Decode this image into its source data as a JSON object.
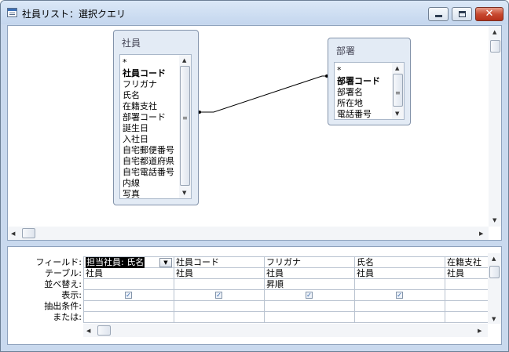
{
  "window": {
    "title": "社員リスト：選択クエリ",
    "minimize_icon": "minimize-icon",
    "maximize_icon": "maximize-icon",
    "close_icon": "close-icon",
    "close_glyph": "✕"
  },
  "tables": {
    "employee": {
      "title": "社員",
      "fields": [
        {
          "label": "*",
          "primary": false
        },
        {
          "label": "社員コード",
          "primary": true
        },
        {
          "label": "フリガナ",
          "primary": false
        },
        {
          "label": "氏名",
          "primary": false
        },
        {
          "label": "在籍支社",
          "primary": false
        },
        {
          "label": "部署コード",
          "primary": false
        },
        {
          "label": "誕生日",
          "primary": false
        },
        {
          "label": "入社日",
          "primary": false
        },
        {
          "label": "自宅郵便番号",
          "primary": false
        },
        {
          "label": "自宅都道府県",
          "primary": false
        },
        {
          "label": "自宅電話番号",
          "primary": false
        },
        {
          "label": "内線",
          "primary": false
        },
        {
          "label": "写真",
          "primary": false
        }
      ]
    },
    "department": {
      "title": "部署",
      "fields": [
        {
          "label": "*",
          "primary": false
        },
        {
          "label": "部署コード",
          "primary": true
        },
        {
          "label": "部署名",
          "primary": false
        },
        {
          "label": "所在地",
          "primary": false
        },
        {
          "label": "電話番号",
          "primary": false
        }
      ]
    }
  },
  "grid": {
    "row_labels": [
      "フィールド:",
      "テーブル:",
      "並べ替え:",
      "表示:",
      "抽出条件:",
      "または:"
    ],
    "columns": [
      {
        "field": "担当社員: 氏名",
        "table": "社員",
        "sort": "",
        "show": true
      },
      {
        "field": "社員コード",
        "table": "社員",
        "sort": "",
        "show": true
      },
      {
        "field": "フリガナ",
        "table": "社員",
        "sort": "昇順",
        "show": true
      },
      {
        "field": "氏名",
        "table": "社員",
        "sort": "",
        "show": true
      },
      {
        "field": "在籍支社",
        "table": "社員",
        "sort": "",
        "show": true
      }
    ],
    "check_glyph": "✓",
    "dropdown_glyph": "▼"
  },
  "scroll": {
    "up": "▲",
    "down": "▼",
    "left": "◀",
    "right": "▶",
    "grip": "≡"
  },
  "colors": {
    "frame": "#c9d9ee",
    "close_button": "#c84a30",
    "selection": "#000000"
  }
}
